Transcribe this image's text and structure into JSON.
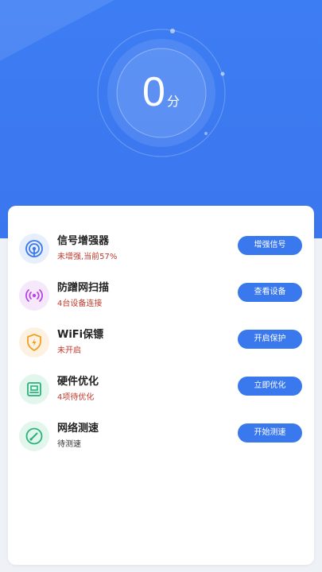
{
  "score": {
    "value": "0",
    "unit": "分"
  },
  "colors": {
    "primary": "#3a78ed",
    "warn_text": "#c0392b",
    "neutral_text": "#333333"
  },
  "items": [
    {
      "title": "信号增强器",
      "subtitle": "未增强,当前57%",
      "button": "增强信号",
      "icon": "signal-booster-icon",
      "subtitle_color": "#c0392b"
    },
    {
      "title": "防蹭网扫描",
      "subtitle": "4台设备连接",
      "button": "查看设备",
      "icon": "wifi-scan-icon",
      "subtitle_color": "#c0392b"
    },
    {
      "title": "WiFi保镖",
      "subtitle": "未开启",
      "button": "开启保护",
      "icon": "shield-bolt-icon",
      "subtitle_color": "#c0392b"
    },
    {
      "title": "硬件优化",
      "subtitle": "4项待优化",
      "button": "立即优化",
      "icon": "hardware-icon",
      "subtitle_color": "#c0392b"
    },
    {
      "title": "网络测速",
      "subtitle": "待测速",
      "button": "开始测速",
      "icon": "speedometer-icon",
      "subtitle_color": "#333333"
    }
  ]
}
